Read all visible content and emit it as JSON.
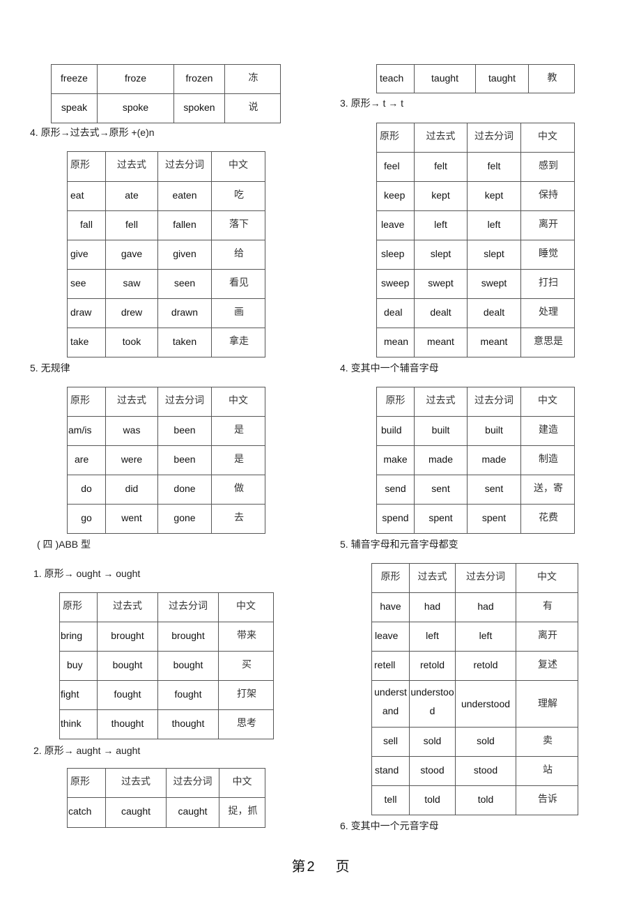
{
  "headers": [
    "原形",
    "过去式",
    "过去分词",
    "中文"
  ],
  "left": {
    "table_top": {
      "rows": [
        [
          "freeze",
          "froze",
          "frozen",
          "冻"
        ],
        [
          "speak",
          "spoke",
          "spoken",
          "说"
        ]
      ]
    },
    "section4": {
      "title": "4. 原形→过去式→原形   +(e)n",
      "rows": [
        [
          "eat",
          "ate",
          "eaten",
          "吃"
        ],
        [
          "fall",
          "fell",
          "fallen",
          "落下"
        ],
        [
          "give",
          "gave",
          "given",
          "给"
        ],
        [
          "see",
          "saw",
          "seen",
          "看见"
        ],
        [
          "draw",
          "drew",
          "drawn",
          "画"
        ],
        [
          "take",
          "took",
          "taken",
          "拿走"
        ]
      ]
    },
    "section5": {
      "title": "5. 无规律",
      "rows": [
        [
          "am/is",
          "was",
          "been",
          "是"
        ],
        [
          "are",
          "were",
          "been",
          "是"
        ],
        [
          "do",
          "did",
          "done",
          "做"
        ],
        [
          "go",
          "went",
          "gone",
          "去"
        ]
      ]
    },
    "part4": {
      "title": "( 四 )ABB 型"
    },
    "ought": {
      "title": "1. 原形→ ought → ought",
      "rows": [
        [
          "bring",
          "brought",
          "brought",
          "带来"
        ],
        [
          "buy",
          "bought",
          "bought",
          "买"
        ],
        [
          "fight",
          "fought",
          "fought",
          "打架"
        ],
        [
          "think",
          "thought",
          "thought",
          "思考"
        ]
      ]
    },
    "aught": {
      "title": "2. 原形→ aught → aught",
      "rows": [
        [
          "catch",
          "caught",
          "caught",
          "捉，抓"
        ]
      ]
    }
  },
  "right": {
    "table_top": {
      "rows": [
        [
          "teach",
          "taught",
          "taught",
          "教"
        ]
      ]
    },
    "section3": {
      "title": "3. 原形→ t → t",
      "rows": [
        [
          "feel",
          "felt",
          "felt",
          "感到"
        ],
        [
          "keep",
          "kept",
          "kept",
          "保持"
        ],
        [
          "leave",
          "left",
          "left",
          "离开"
        ],
        [
          "sleep",
          "slept",
          "slept",
          "睡觉"
        ],
        [
          "sweep",
          "swept",
          "swept",
          "打扫"
        ],
        [
          "deal",
          "dealt",
          "dealt",
          "处理"
        ],
        [
          "mean",
          "meant",
          "meant",
          "意思是"
        ]
      ]
    },
    "section4": {
      "title": "4. 变其中一个辅音字母",
      "rows": [
        [
          "build",
          "built",
          "built",
          "建造"
        ],
        [
          "make",
          "made",
          "made",
          "制造"
        ],
        [
          "send",
          "sent",
          "sent",
          "送，寄"
        ],
        [
          "spend",
          "spent",
          "spent",
          "花费"
        ]
      ]
    },
    "section5": {
      "title": "5. 辅音字母和元音字母都变",
      "rows": [
        [
          "have",
          "had",
          "had",
          "有"
        ],
        [
          "leave",
          "left",
          "left",
          "离开"
        ],
        [
          "retell",
          "retold",
          "retold",
          "复述"
        ],
        [
          "understand",
          "understood",
          "understood",
          "理解"
        ],
        [
          "sell",
          "sold",
          "sold",
          "卖"
        ],
        [
          "stand",
          "stood",
          "stood",
          "站"
        ],
        [
          "tell",
          "told",
          "told",
          "告诉"
        ]
      ]
    },
    "section6": {
      "title": "6. 变其中一个元音字母"
    }
  },
  "footer": {
    "prefix": "第",
    "page_number": "2",
    "suffix": "页"
  }
}
